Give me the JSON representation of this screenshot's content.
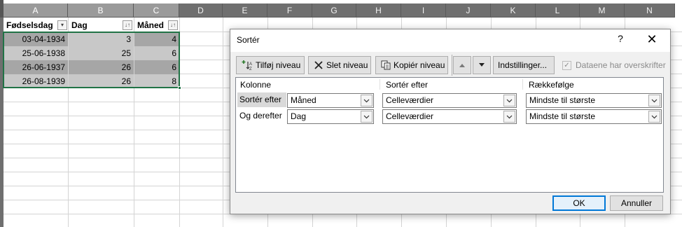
{
  "spreadsheet": {
    "columns": [
      "A",
      "B",
      "C",
      "D",
      "E",
      "F",
      "G",
      "H",
      "I",
      "J",
      "K",
      "L",
      "M",
      "N"
    ],
    "selected_columns": [
      "A",
      "B",
      "C"
    ],
    "header": {
      "a": "Fødselsdag",
      "b": "Dag",
      "c": "Måned"
    },
    "rows": [
      {
        "a": "03-04-1934",
        "b": "3",
        "c": "4"
      },
      {
        "a": "25-06-1938",
        "b": "25",
        "c": "6"
      },
      {
        "a": "26-06-1937",
        "b": "26",
        "c": "6"
      },
      {
        "a": "26-08-1939",
        "b": "26",
        "c": "8"
      }
    ],
    "accent_color": "#217346"
  },
  "dialog": {
    "title": "Sortér",
    "help": "?",
    "close": "✕",
    "toolbar": {
      "add_level": "Tilføj niveau",
      "delete_level": "Slet niveau",
      "copy_level": "Kopiér niveau",
      "options": "Indstillinger...",
      "header_checkbox_label": "Dataene har overskrifter",
      "header_checkbox_checked": true
    },
    "list_headers": {
      "column": "Kolonne",
      "sort_on": "Sortér efter",
      "order": "Rækkefølge"
    },
    "levels": [
      {
        "label": "Sortér efter",
        "column": "Måned",
        "sort_on": "Celleværdier",
        "order": "Mindste til største"
      },
      {
        "label": "Og derefter",
        "column": "Dag",
        "sort_on": "Celleværdier",
        "order": "Mindste til største"
      }
    ],
    "ok": "OK",
    "cancel": "Annuller",
    "accent_color": "#0078d7"
  }
}
